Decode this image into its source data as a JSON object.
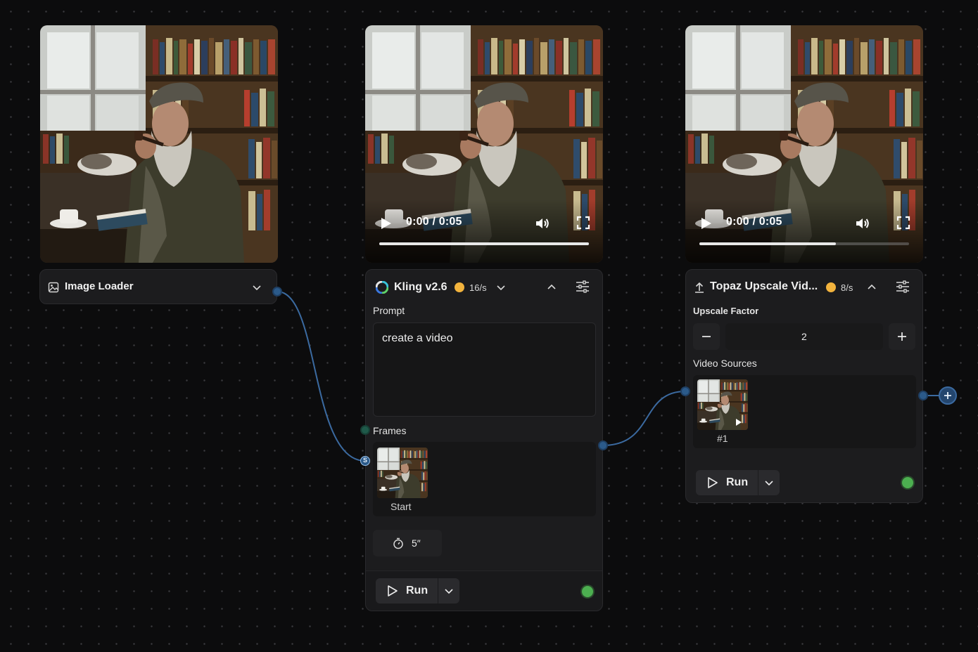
{
  "image_loader": {
    "title": "Image Loader"
  },
  "kling": {
    "title": "Kling v2.6",
    "rate": "16/s",
    "video": {
      "time": "0:00 / 0:05",
      "progress": 1.0
    },
    "prompt_label": "Prompt",
    "prompt_value": "create a video",
    "frames_label": "Frames",
    "frame_caption": "Start",
    "duration": "5″",
    "run_label": "Run",
    "port_label": "S"
  },
  "topaz": {
    "title": "Topaz Upscale Vid...",
    "rate": "8/s",
    "video": {
      "time": "0:00 / 0:05",
      "progress": 0.65
    },
    "upscale_label": "Upscale Factor",
    "upscale_value": "2",
    "sources_label": "Video Sources",
    "source_caption": "#1",
    "run_label": "Run"
  },
  "colors": {
    "canvas": "#0c0c0d",
    "panel": "#1c1c1e",
    "edge": "#3b6aa0",
    "badge": "#f2b33d",
    "status": "#4caf50"
  }
}
